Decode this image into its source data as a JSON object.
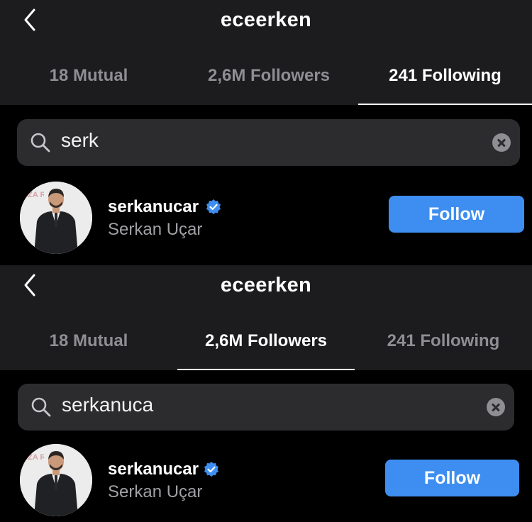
{
  "panels": [
    {
      "title": "eceerken",
      "tabs": [
        {
          "label": "18 Mutual",
          "active": false
        },
        {
          "label": "2,6M Followers",
          "active": false
        },
        {
          "label": "241 Following",
          "active": true
        }
      ],
      "search": {
        "value": "serk"
      },
      "result": {
        "username": "serkanucar",
        "verified": true,
        "full_name": "Serkan Uçar",
        "follow_label": "Follow",
        "avatar_backdrop_text": "MZA RENI"
      }
    },
    {
      "title": "eceerken",
      "tabs": [
        {
          "label": "18 Mutual",
          "active": false
        },
        {
          "label": "2,6M Followers",
          "active": true
        },
        {
          "label": "241 Following",
          "active": false
        }
      ],
      "search": {
        "value": "serkanuca"
      },
      "result": {
        "username": "serkanucar",
        "verified": true,
        "full_name": "Serkan Uçar",
        "follow_label": "Follow",
        "avatar_backdrop_text": "MZA RENI"
      }
    }
  ],
  "colors": {
    "background": "#000000",
    "header_bg": "#1c1c1e",
    "search_bg": "#2c2c2e",
    "follow_button": "#3d8ef0",
    "verified_badge": "#3d8ef0",
    "muted_text": "#8e8e93"
  },
  "icons": [
    "chevron-left-icon",
    "search-icon",
    "clear-icon",
    "verified-badge-icon"
  ]
}
